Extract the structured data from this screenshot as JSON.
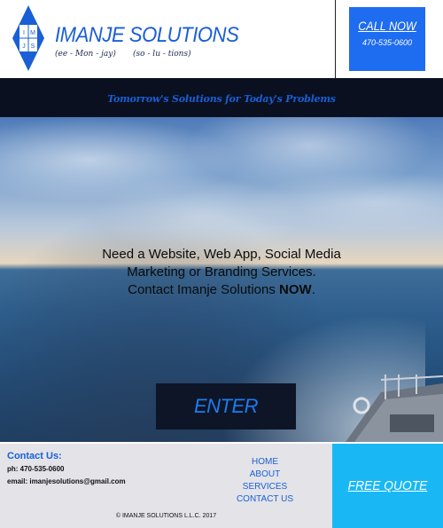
{
  "header": {
    "logo_letters": [
      "I",
      "M",
      "J",
      "S"
    ],
    "brand_name": "IMANJE SOLUTIONS",
    "pronunciation_1": "(ee - Mon - jay)",
    "pronunciation_2": "(so - lu - tions)",
    "call_label": "CALL NOW",
    "call_phone": "470-535-0600"
  },
  "tagline": "Tomorrow's Solutions for Today's Problems",
  "hero": {
    "line1": "Need a Website, Web App, Social Media",
    "line2": "Marketing or Branding Services.",
    "line3_prefix": "Contact Imanje Solutions ",
    "line3_bold": "NOW",
    "line3_suffix": ".",
    "enter_label": "ENTER"
  },
  "footer": {
    "contact_title": "Contact Us:",
    "phone": "ph: 470-535-0600",
    "email": "email: imanjesolutions@gmail.com",
    "nav": [
      "HOME",
      "ABOUT",
      "SERVICES",
      "CONTACT US"
    ],
    "copyright": "© IMANJE SOLUTIONS L.L.C. 2017",
    "quote_label": "FREE QUOTE"
  },
  "colors": {
    "brand_blue": "#1a5fd6",
    "call_box": "#1e6cf0",
    "quote_box": "#19b8f4",
    "dark_bar": "#0a1020"
  }
}
